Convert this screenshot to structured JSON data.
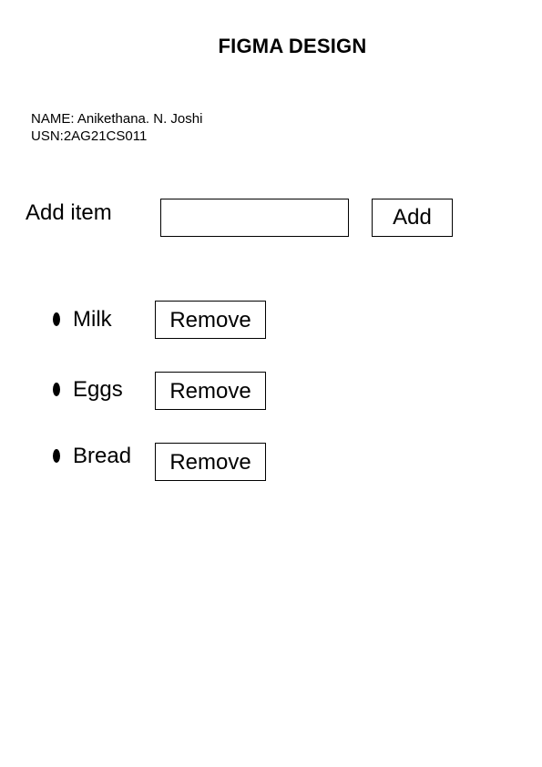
{
  "header": {
    "title": "FIGMA DESIGN"
  },
  "student": {
    "name_line": "NAME: Anikethana. N. Joshi",
    "usn_line": "USN:2AG21CS011"
  },
  "add_form": {
    "label": "Add item",
    "input_value": "",
    "input_placeholder": "",
    "button_label": "Add"
  },
  "items": [
    {
      "label": "Milk",
      "remove_label": "Remove"
    },
    {
      "label": "Eggs",
      "remove_label": "Remove"
    },
    {
      "label": "Bread",
      "remove_label": "Remove"
    }
  ],
  "colors": {
    "text": "#000000",
    "background": "#ffffff",
    "border": "#000000"
  }
}
